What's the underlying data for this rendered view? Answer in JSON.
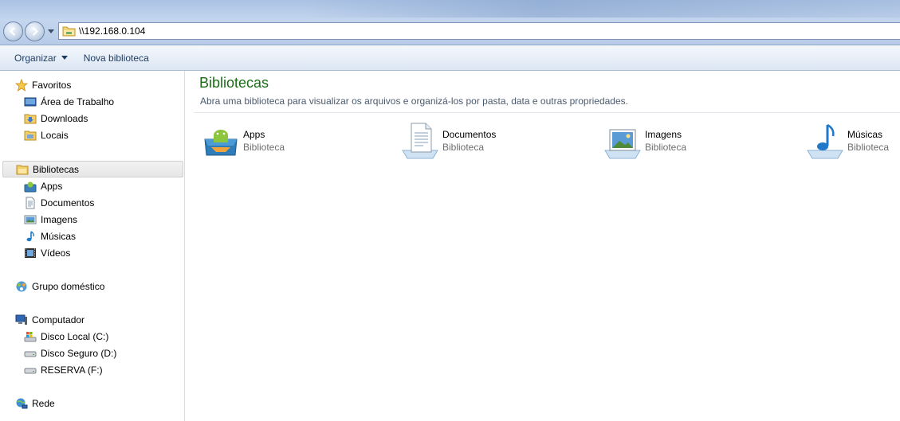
{
  "address": {
    "path": "\\\\192.168.0.104"
  },
  "toolbar": {
    "organize_label": "Organizar",
    "new_library_label": "Nova biblioteca"
  },
  "nav": {
    "favorites": {
      "label": "Favoritos",
      "items": [
        {
          "label": "Área de Trabalho",
          "icon": "desktop-icon"
        },
        {
          "label": "Downloads",
          "icon": "downloads-folder-icon"
        },
        {
          "label": "Locais",
          "icon": "places-icon"
        }
      ]
    },
    "libraries": {
      "label": "Bibliotecas",
      "items": [
        {
          "label": "Apps",
          "icon": "apps-library-icon"
        },
        {
          "label": "Documentos",
          "icon": "documents-icon"
        },
        {
          "label": "Imagens",
          "icon": "pictures-icon"
        },
        {
          "label": "Músicas",
          "icon": "music-icon"
        },
        {
          "label": "Vídeos",
          "icon": "videos-icon"
        }
      ]
    },
    "homegroup": {
      "label": "Grupo doméstico"
    },
    "computer": {
      "label": "Computador",
      "items": [
        {
          "label": "Disco Local (C:)",
          "icon": "system-drive-icon"
        },
        {
          "label": "Disco Seguro (D:)",
          "icon": "drive-icon"
        },
        {
          "label": "RESERVA (F:)",
          "icon": "drive-icon"
        }
      ]
    },
    "network": {
      "label": "Rede"
    }
  },
  "main": {
    "title": "Bibliotecas",
    "subtitle": "Abra uma biblioteca para visualizar os arquivos e organizá-los por pasta, data e outras propriedades.",
    "libraries": [
      {
        "name": "Apps",
        "type": "Biblioteca",
        "icon": "apps-library-icon"
      },
      {
        "name": "Documentos",
        "type": "Biblioteca",
        "icon": "documents-library-icon"
      },
      {
        "name": "Imagens",
        "type": "Biblioteca",
        "icon": "pictures-library-icon"
      },
      {
        "name": "Músicas",
        "type": "Biblioteca",
        "icon": "music-library-icon"
      }
    ]
  },
  "colors": {
    "title_green": "#1a6d16",
    "toolbar_text": "#1e3a5f",
    "selection_gray": "#e6e6e6"
  }
}
